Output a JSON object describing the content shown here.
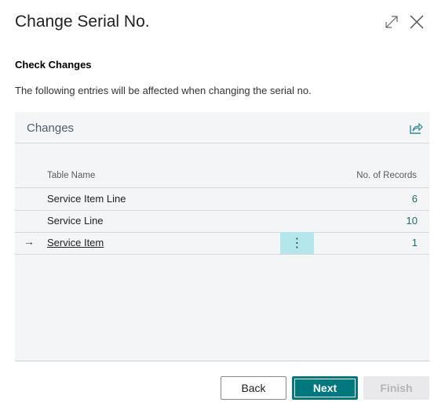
{
  "dialog": {
    "title": "Change Serial No.",
    "section_title": "Check Changes",
    "instruction": "The following entries will be affected when changing the serial no."
  },
  "icons": {
    "expand": "expand-icon",
    "close": "close-icon",
    "share": "share-icon",
    "arrow": "→",
    "more": "⋮"
  },
  "changes": {
    "title": "Changes",
    "columns": [
      "Table Name",
      "No. of Records"
    ],
    "rows": [
      {
        "table_name": "Service Item Line",
        "records": "6",
        "selected": false
      },
      {
        "table_name": "Service Line",
        "records": "10",
        "selected": false
      },
      {
        "table_name": "Service Item",
        "records": "1",
        "selected": true
      }
    ]
  },
  "buttons": {
    "back": "Back",
    "next": "Next",
    "finish": "Finish"
  }
}
